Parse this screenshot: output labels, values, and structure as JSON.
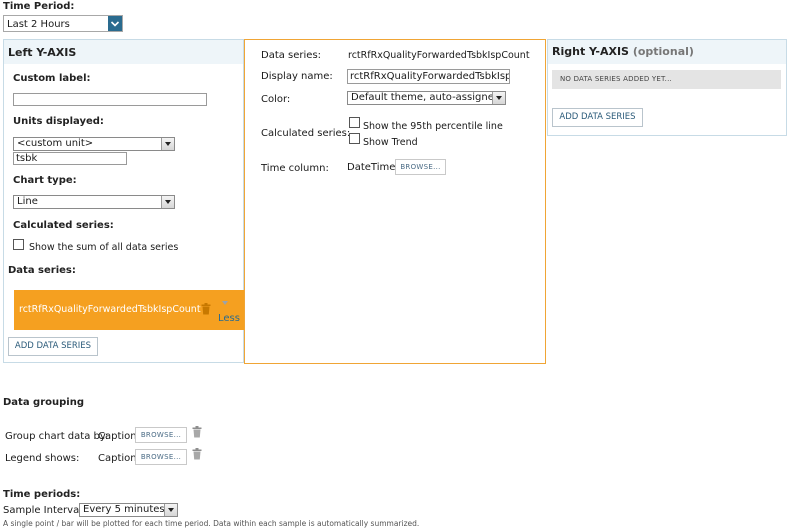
{
  "time_period": {
    "label": "Time Period:",
    "selected": "Last 2 Hours"
  },
  "left_axis": {
    "title": "Left Y-AXIS",
    "custom_label": {
      "label": "Custom label:",
      "value": ""
    },
    "units": {
      "label": "Units displayed:",
      "selected": "<custom unit>",
      "value": "tsbk"
    },
    "chart_type": {
      "label": "Chart type:",
      "selected": "Line"
    },
    "calculated": {
      "label": "Calculated series:",
      "option": "Show the sum of all data series"
    },
    "data_series": {
      "label": "Data series:",
      "item": "rctRfRxQualityForwardedTsbkIspCount",
      "less_link": "Less"
    },
    "add_button": "ADD DATA SERIES"
  },
  "series_detail": {
    "data_series_label": "Data series:",
    "data_series_value": "rctRfRxQualityForwardedTsbkIspCount",
    "display_name_label": "Display name:",
    "display_name_value": "rctRfRxQualityForwardedTsbkIspCo",
    "color_label": "Color:",
    "color_selected": "Default theme, auto-assigned",
    "calc_label": "Calculated series:",
    "calc_option_1": "Show the 95th percentile line",
    "calc_option_2": "Show Trend",
    "time_column_label": "Time column:",
    "time_column_value": "DateTime",
    "browse": "BROWSE..."
  },
  "right_axis": {
    "title": "Right Y-AXIS",
    "optional": "(optional)",
    "empty_message": "NO DATA SERIES ADDED YET...",
    "add_button": "ADD DATA SERIES"
  },
  "grouping": {
    "title": "Data grouping",
    "group_by_label": "Group chart data by:",
    "group_by_value": "Caption",
    "legend_label": "Legend shows:",
    "legend_value": "Caption",
    "browse": "BROWSE..."
  },
  "time_periods": {
    "title": "Time periods:",
    "interval_label": "Sample Interval:",
    "interval_selected": "Every 5 minutes",
    "note": "A single point / bar will be plotted for each time period. Data within each sample is automatically summarized."
  },
  "colors": {
    "panel_border": "#c7dbe6",
    "panel_header_bg": "#eef5f9",
    "accent_orange": "#f5a020",
    "select_arrow_blue": "#2a6b8f"
  }
}
